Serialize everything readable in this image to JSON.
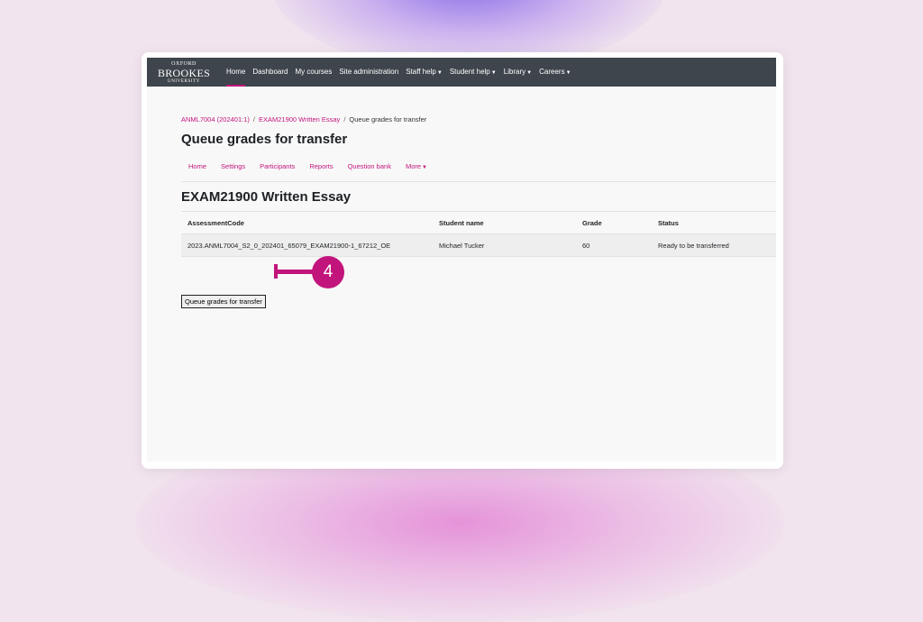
{
  "logo": {
    "line1": "OXFORD",
    "line2": "BROOKES",
    "line3": "UNIVERSITY"
  },
  "nav": {
    "items": [
      {
        "label": "Home",
        "active": true,
        "dropdown": false
      },
      {
        "label": "Dashboard",
        "dropdown": false
      },
      {
        "label": "My courses",
        "dropdown": false
      },
      {
        "label": "Site administration",
        "dropdown": false
      },
      {
        "label": "Staff help",
        "dropdown": true
      },
      {
        "label": "Student help",
        "dropdown": true
      },
      {
        "label": "Library",
        "dropdown": true
      },
      {
        "label": "Careers",
        "dropdown": true
      }
    ]
  },
  "breadcrumb": [
    {
      "label": "ANML7004 (202401:1)",
      "link": true
    },
    {
      "label": "EXAM21900 Written Essay",
      "link": true
    },
    {
      "label": "Queue grades for transfer",
      "link": false
    }
  ],
  "page_title": "Queue grades for transfer",
  "tabs": [
    {
      "label": "Home"
    },
    {
      "label": "Settings"
    },
    {
      "label": "Participants"
    },
    {
      "label": "Reports"
    },
    {
      "label": "Question bank"
    },
    {
      "label": "More",
      "dropdown": true
    }
  ],
  "section_title": "EXAM21900 Written Essay",
  "table": {
    "headers": [
      "AssessmentCode",
      "Student name",
      "Grade",
      "Status"
    ],
    "rows": [
      [
        "2023.ANML7004_S2_0_202401_65079_EXAM21900-1_67212_OE",
        "Michael Tucker",
        "60",
        "Ready to be transferred"
      ]
    ]
  },
  "queue_button_label": "Queue grades for transfer",
  "callout_number": "4",
  "colors": {
    "accent": "#c2157c",
    "navbar": "#3e454c",
    "glow_top": "#7a5ae6",
    "glow_bottom": "#e078d2"
  }
}
